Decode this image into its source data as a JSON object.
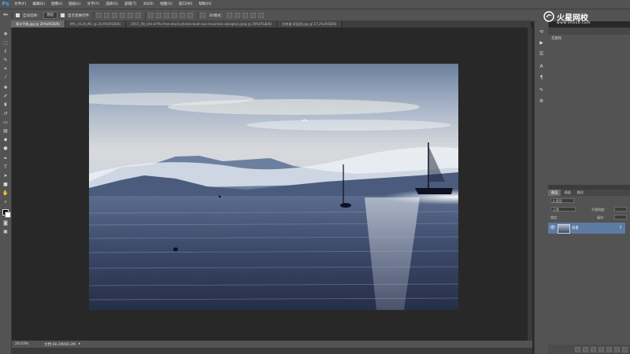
{
  "app": {
    "logo": "Ps"
  },
  "menu": [
    "文件(F)",
    "编辑(E)",
    "图像(I)",
    "图层(L)",
    "文字(Y)",
    "选择(S)",
    "滤镜(T)",
    "3D(D)",
    "视图(V)",
    "窗口(W)",
    "帮助(H)"
  ],
  "options": {
    "auto_select_label": "自动选择：",
    "auto_select_value": "图层",
    "show_transform_label": "显示变换控件",
    "mode_label": "3D模式："
  },
  "tabs": [
    {
      "label": "垂水平线.jpg @ 20%(RGB/8)",
      "active": true
    },
    {
      "label": "IMG_0126.JPG @ 20.6%(RGB/8)",
      "active": false
    },
    {
      "label": "2015_09_Life-of-Pix-free-stock-photos-boat-sea-mountain-abington.jpeg @ 20%(RGB/8)",
      "active": false
    },
    {
      "label": "台南道 奇园池.jpg @ 17.2%(RGB/8)",
      "active": false
    }
  ],
  "status": {
    "zoom": "20.03%",
    "doc": "文档:60.2M/60.2M"
  },
  "properties": {
    "title": "无属性"
  },
  "layers": {
    "tabs": [
      "图层",
      "通道",
      "路径"
    ],
    "filter": "ρ 类型",
    "blend_mode": "正常",
    "opacity_label": "不透明度：",
    "lock_label": "锁定：",
    "fill_label": "填充：",
    "layer_name": "背景"
  },
  "watermark": {
    "title": "火星网校",
    "url": "www.vhxsd.com"
  },
  "colors": {
    "ps_blue": "#31a8ff",
    "selected_layer": "#5d7aa3",
    "panel_bg": "#535353",
    "canvas_bg": "#282828"
  }
}
